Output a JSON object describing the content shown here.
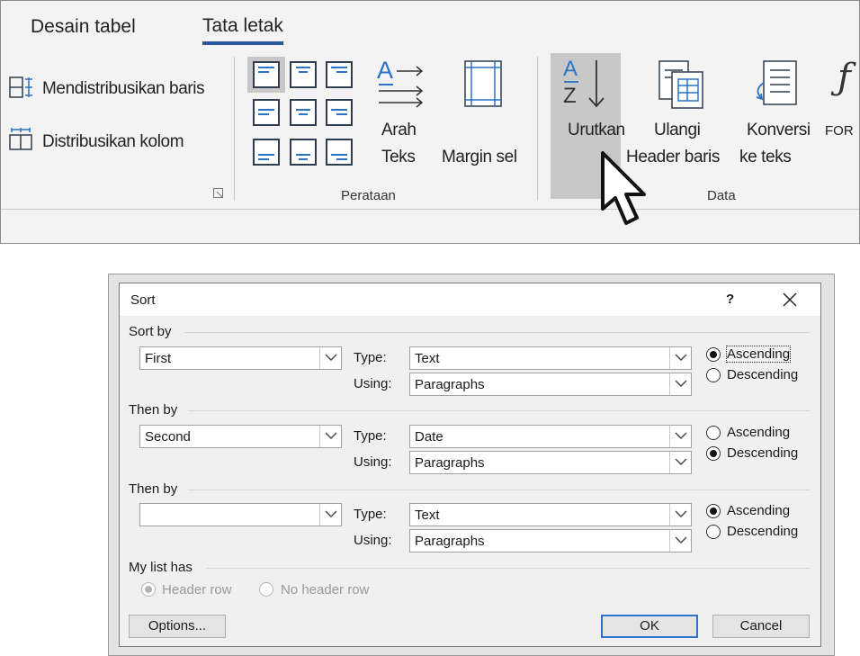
{
  "ribbon": {
    "tabs": [
      {
        "label": "Desain tabel"
      },
      {
        "label": "Tata letak"
      }
    ],
    "distribute_rows": "Mendistribusikan baris",
    "distribute_cols": "Distribusikan kolom",
    "text_direction_line1": "Arah",
    "text_direction_line2": "Teks",
    "cell_margin": "Margin sel",
    "alignment_group": "Perataan",
    "sort_label": "Urutkan",
    "repeat_header_line1": "Ulangi",
    "repeat_header_line2": "Header baris",
    "convert_line1": "Konversi",
    "convert_line2": "ke teks",
    "formula_partial": "FOR",
    "data_group": "Data",
    "az_a": "A",
    "az_z": "Z",
    "dir_a": "A"
  },
  "dialog": {
    "title": "Sort",
    "help": "?",
    "sort_by_label": "Sort by",
    "then_by_1_label": "Then by",
    "then_by_2_label": "Then by",
    "type_label": "Type:",
    "using_label": "Using:",
    "rows": [
      {
        "field": "First",
        "type": "Text",
        "using": "Paragraphs",
        "ascending": true
      },
      {
        "field": "Second",
        "type": "Date",
        "using": "Paragraphs",
        "ascending": false
      },
      {
        "field": "",
        "type": "Text",
        "using": "Paragraphs",
        "ascending": true
      }
    ],
    "ascending": "Ascending",
    "descending": "Descending",
    "my_list_has": "My list has",
    "header_row": "Header row",
    "no_header_row": "No header row",
    "options_button": "Options...",
    "ok_button": "OK",
    "cancel_button": "Cancel"
  }
}
